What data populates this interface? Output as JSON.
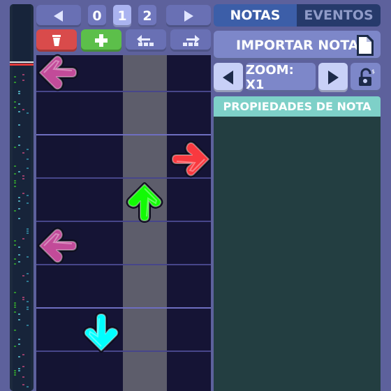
{
  "toolbar": {
    "pages": [
      "0",
      "1",
      "2"
    ],
    "active_page": "1",
    "tools": [
      {
        "name": "delete",
        "icon": "trash-icon",
        "color": "#d94b4b"
      },
      {
        "name": "add",
        "icon": "plus-icon",
        "color": "#5cbf4a"
      },
      {
        "name": "shift-left",
        "icon": "move-left-icon",
        "color": "#6970b4"
      },
      {
        "name": "shift-right",
        "icon": "move-right-icon",
        "color": "#6970b4"
      }
    ]
  },
  "tabs": {
    "notes": "NOTAS",
    "events": "EVENTOS",
    "active": "NOTAS"
  },
  "import_label": "IMPORTAR NOTAS",
  "zoom_label": "ZOOM: X1",
  "properties_title": "PROPIEDADES DE NOTA",
  "chart": {
    "lane_count": 4,
    "highlighted_lane": 2,
    "notes": [
      {
        "direction": "left",
        "lane": 0,
        "row": 0,
        "color": "#c24b99"
      },
      {
        "direction": "right",
        "lane": 3,
        "row": 2,
        "color": "#f9393f"
      },
      {
        "direction": "up",
        "lane": 2,
        "row": 3,
        "color": "#12fa05"
      },
      {
        "direction": "left",
        "lane": 0,
        "row": 4,
        "color": "#c24b99"
      },
      {
        "direction": "down",
        "lane": 1,
        "row": 6,
        "color": "#00ffff"
      }
    ]
  },
  "colors": {
    "background": "#5d619c",
    "grid": "#151434",
    "panel": "#233e41",
    "accent": "#7ed0c8"
  }
}
